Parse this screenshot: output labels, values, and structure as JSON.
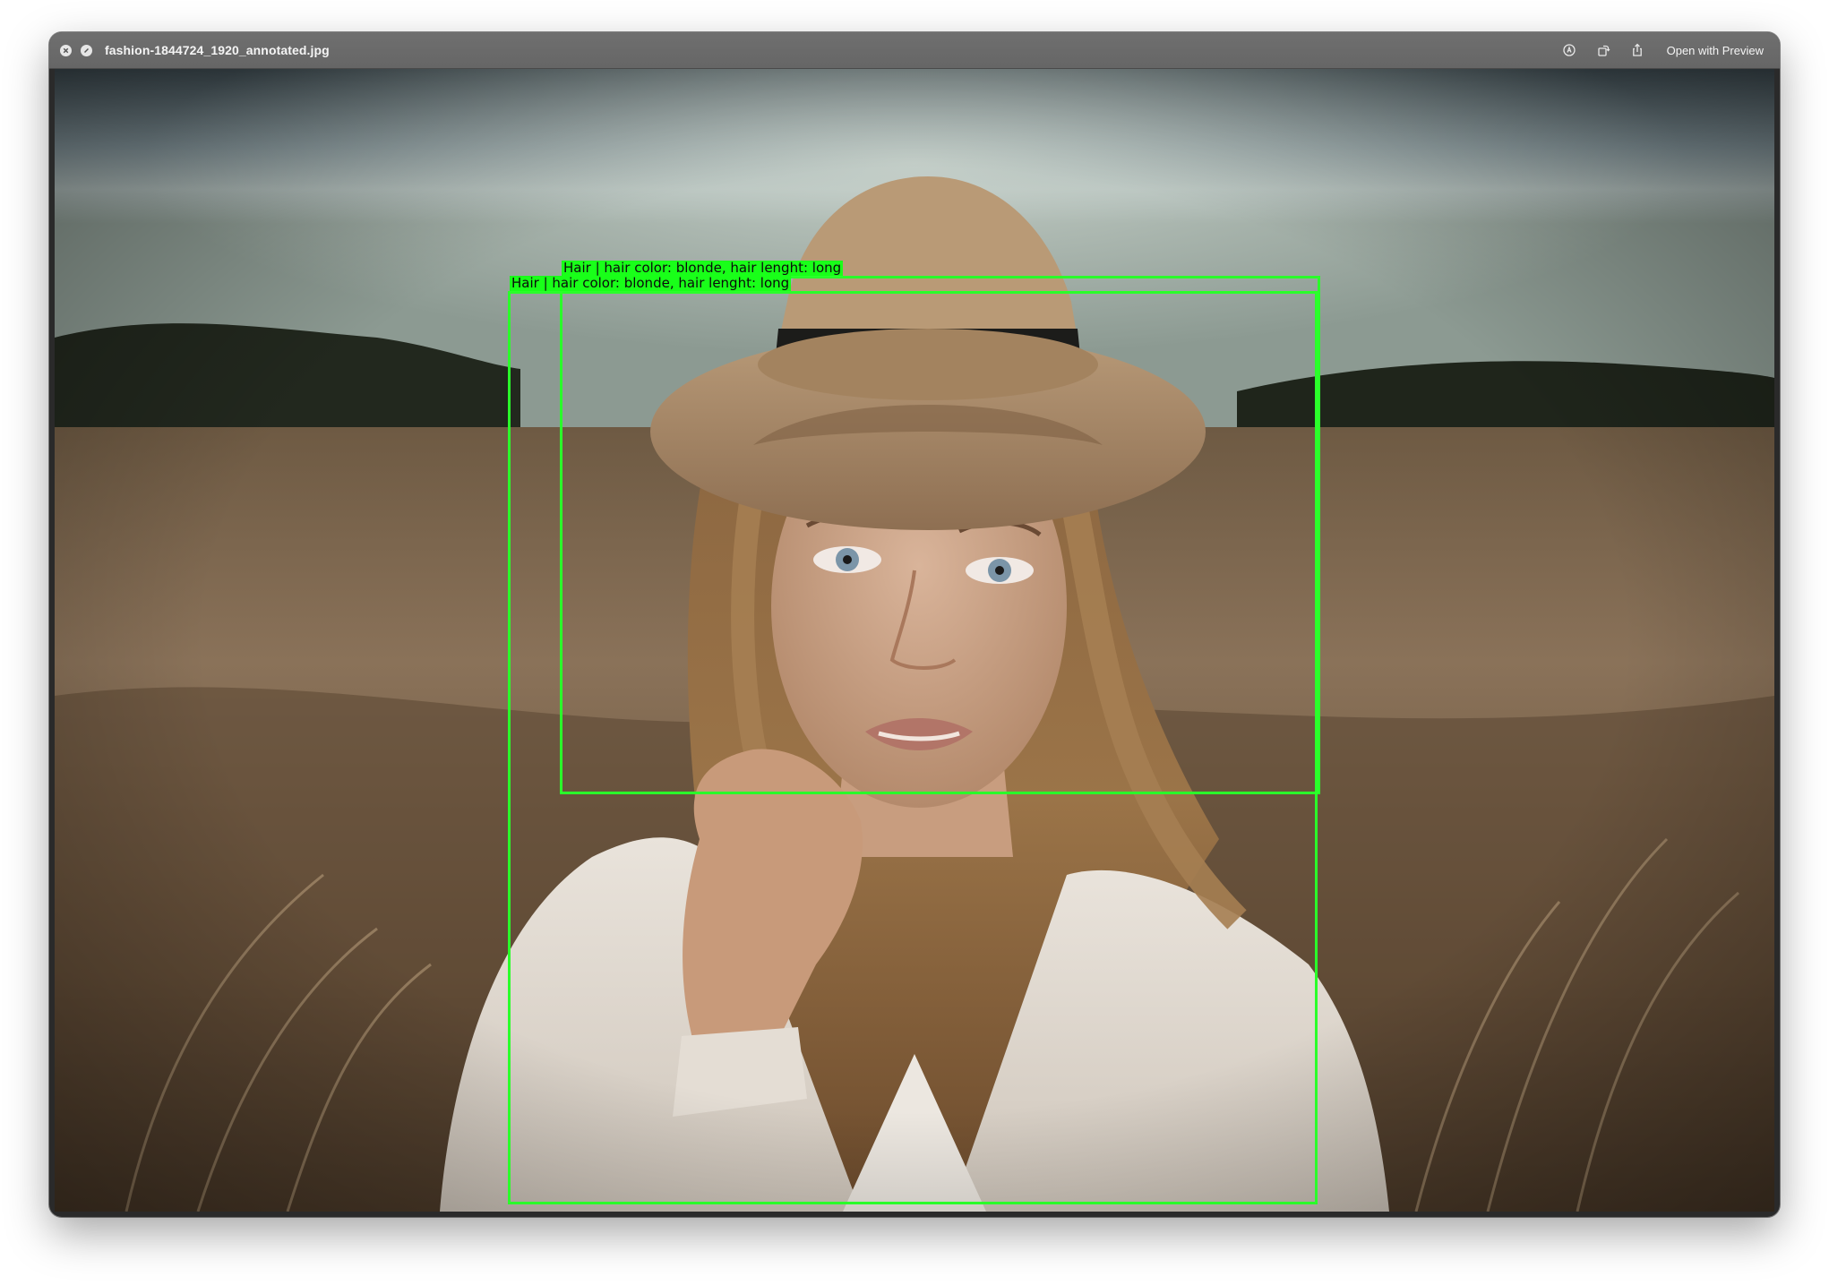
{
  "window": {
    "title": "fashion-1844724_1920_annotated.jpg",
    "open_with_label": "Open with Preview"
  },
  "icons": {
    "close": "close-icon",
    "minimize": "minimize-icon",
    "markup": "markup-pen-icon",
    "rotate": "rotate-icon",
    "share": "share-icon"
  },
  "annotations": [
    {
      "label": "Hair | hair color: blonde, hair lenght: long",
      "color": "#19ff19"
    },
    {
      "label": "Hair | hair color: blonde, hair lenght: long",
      "color": "#19ff19"
    }
  ],
  "photo": {
    "subject": "woman in wide-brim tan hat in a wheat field"
  }
}
